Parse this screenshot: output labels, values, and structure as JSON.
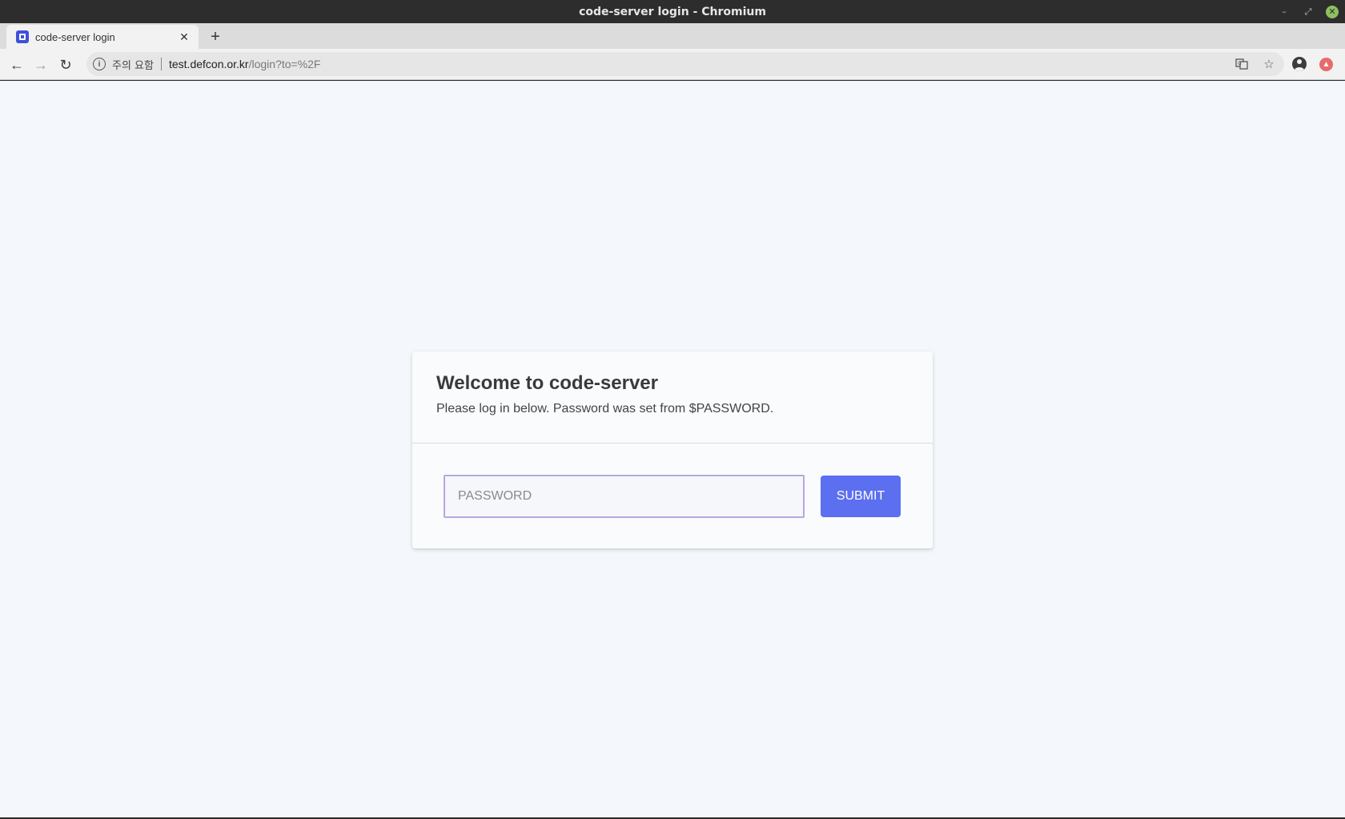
{
  "window": {
    "title": "code-server login - Chromium",
    "controls": {
      "minimize_icon": "minimize-icon",
      "maximize_icon": "maximize-icon",
      "close_icon": "close-icon",
      "close_color": "#8fbf5f"
    }
  },
  "tabs": [
    {
      "title": "code-server login",
      "active": true,
      "favicon": "code-server-icon",
      "favicon_color": "#3f51d8"
    }
  ],
  "toolbar": {
    "back_icon": "arrow-left-icon",
    "forward_icon": "arrow-right-icon",
    "reload_icon": "reload-icon",
    "security_label": "주의 요함",
    "url_host": "test.defcon.or.kr",
    "url_path": "/login?to=%2F",
    "translate_icon": "translate-icon",
    "bookmark_icon": "star-icon",
    "profile_icon": "profile-icon",
    "extension_icon": "extension-icon"
  },
  "login": {
    "title": "Welcome to code-server",
    "subtitle": "Please log in below. Password was set from $PASSWORD.",
    "password_placeholder": "PASSWORD",
    "password_value": "",
    "submit_label": "SUBMIT",
    "accent_color": "#5c6ff0",
    "focus_border_color": "#b9a6e0"
  },
  "colors": {
    "page_background": "#f4f7fb",
    "card_background": "#f9fbfd"
  }
}
